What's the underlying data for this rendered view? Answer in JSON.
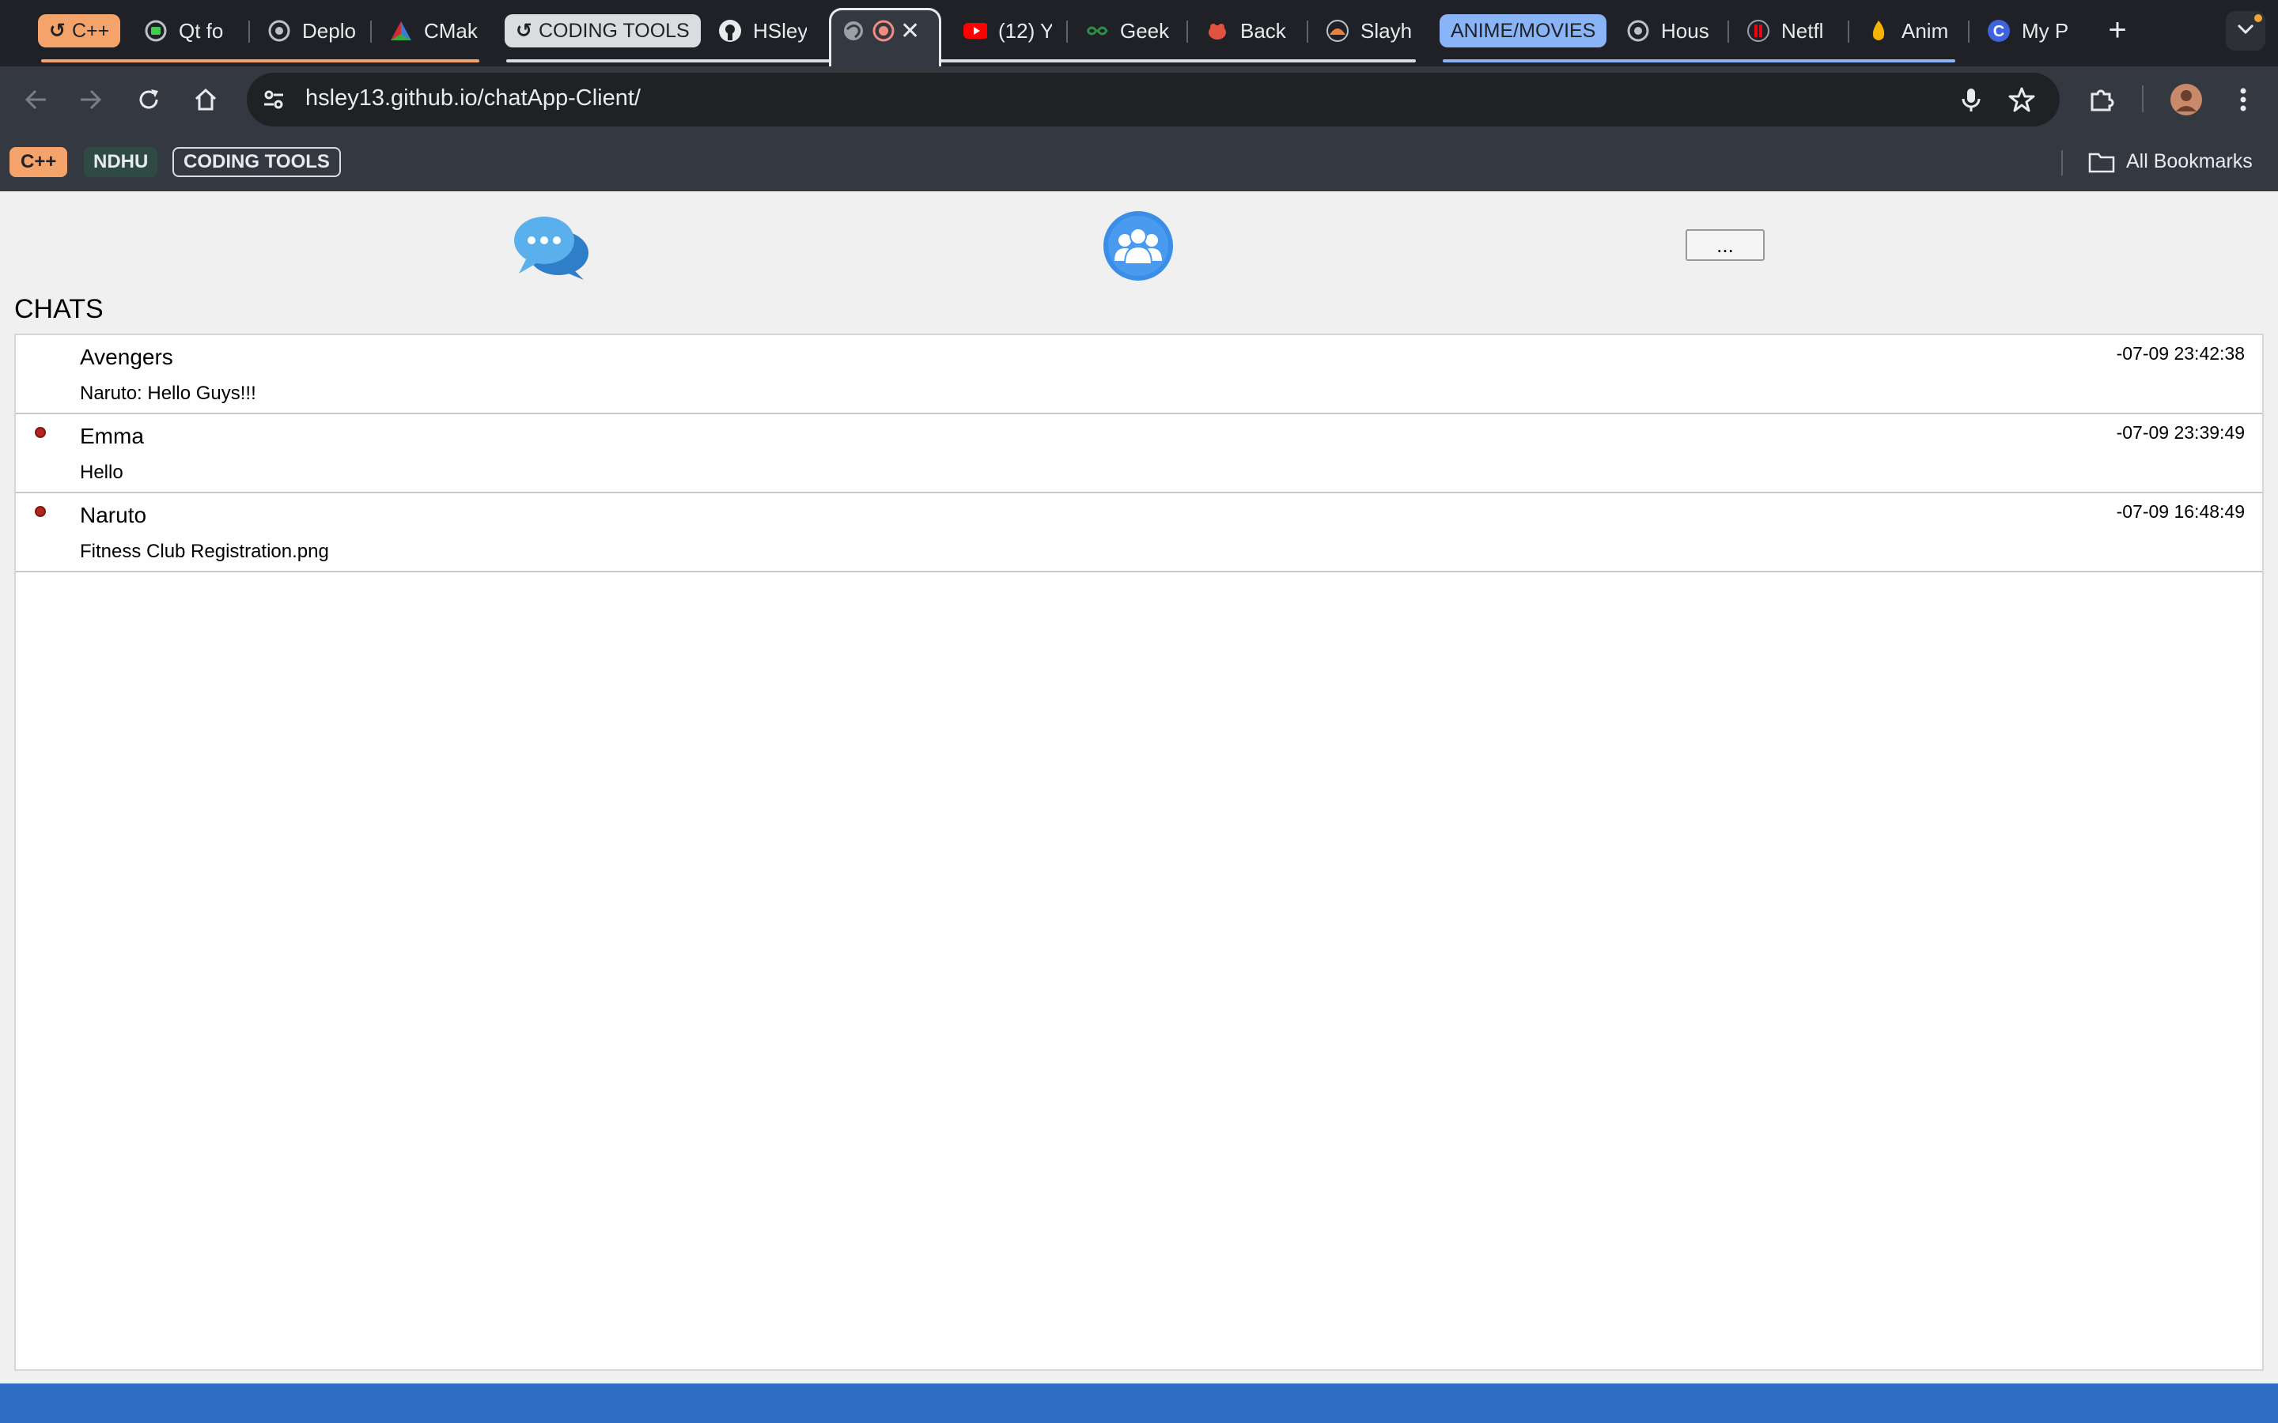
{
  "browser": {
    "tabs": [
      {
        "group": "C++",
        "label": "C++",
        "icon": "tab-group-glyph"
      },
      {
        "label": "Qt fo",
        "icon": "qt-icon"
      },
      {
        "label": "Deplo",
        "icon": "globe-icon"
      },
      {
        "label": "CMak",
        "icon": "cmake-icon"
      },
      {
        "group": "CODING TOOLS",
        "label": "CODING TOOLS",
        "icon": "tab-group-glyph"
      },
      {
        "label": "HSley",
        "icon": "github-icon"
      },
      {
        "label": "",
        "icon": "globe-icon",
        "active": true
      },
      {
        "label": "(12) Y",
        "icon": "youtube-icon"
      },
      {
        "label": "Geek",
        "icon": "geeks-icon"
      },
      {
        "label": "Back",
        "icon": "bug-icon"
      },
      {
        "label": "Slayh",
        "icon": "slay-icon"
      },
      {
        "group": "ANIME/MOVIES",
        "label": "ANIME/MOVIES"
      },
      {
        "label": "Hous",
        "icon": "globe-icon"
      },
      {
        "label": "Netfl",
        "icon": "netflix-icon"
      },
      {
        "label": "Anim",
        "icon": "flame-icon"
      },
      {
        "label": "My P",
        "icon": "c-icon"
      }
    ],
    "url": "hsley13.github.io/chatApp-Client/",
    "bookmarks": {
      "chip_cpp": "C++",
      "chip_ndhu": "NDHU",
      "chip_coding": "CODING TOOLS",
      "all": "All Bookmarks"
    },
    "colors": {
      "cpp_group": "#f4a46a",
      "coding_group": "#dadce0",
      "anime_group": "#8ab4f8",
      "ndhu_group": "#2f4a45"
    }
  },
  "app": {
    "more_button": "...",
    "section_title": "CHATS",
    "chats": [
      {
        "name": "Avengers",
        "preview": "Naruto: Hello Guys!!!",
        "time": "-07-09 23:42:38",
        "unread": false
      },
      {
        "name": "Emma",
        "preview": "Hello",
        "time": "-07-09 23:39:49",
        "unread": true
      },
      {
        "name": "Naruto",
        "preview": "Fitness Club Registration.png",
        "time": "-07-09 16:48:49",
        "unread": true
      }
    ],
    "accent": "#2f6ec4"
  }
}
